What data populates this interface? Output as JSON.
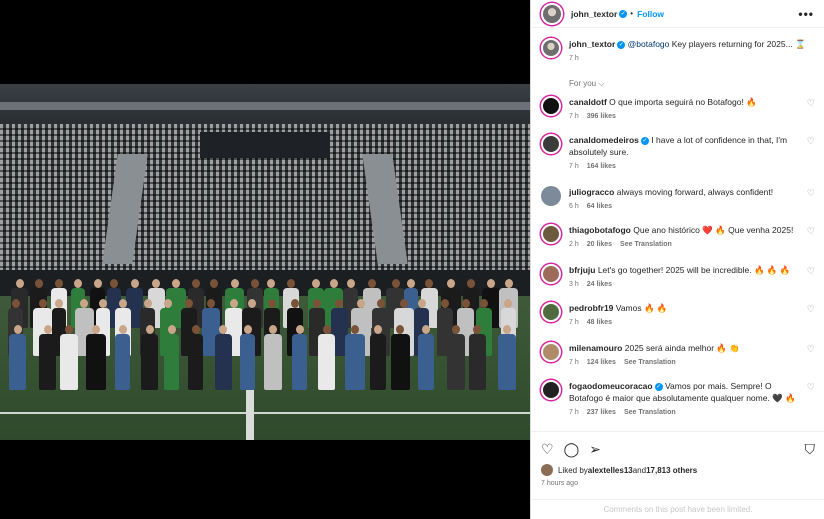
{
  "header": {
    "username": "john_textor",
    "verified_mark": "✓",
    "follow_label": "Follow",
    "more_label": "•••"
  },
  "caption": {
    "username": "john_textor",
    "mention": "@botafogo",
    "text": " Key players returning for 2025... ⌛",
    "time": "7 h"
  },
  "for_you_label": "For you ⌵",
  "comments": [
    {
      "username": "canaldotf",
      "verified": false,
      "text": "O que importa seguirá no Botafogo! 🔥",
      "time": "7 h",
      "likes": "396 likes",
      "translate": "",
      "avatar_color": "#111111"
    },
    {
      "username": "canaldomedeiros",
      "verified": true,
      "text": "I have a lot of confidence in that, I'm absolutely sure.",
      "time": "7 h",
      "likes": "164 likes",
      "translate": "",
      "avatar_color": "#3b3b3b"
    },
    {
      "username": "juliogracco",
      "verified": false,
      "text": "always moving forward, always confident!",
      "time": "6 h",
      "likes": "64 likes",
      "translate": "",
      "avatar_color": "#7d8a99"
    },
    {
      "username": "thiagobotafogo",
      "verified": false,
      "text": "Que ano histórico ❤️ 🔥 Que venha 2025!",
      "time": "2 h",
      "likes": "20 likes",
      "translate": "See Translation",
      "avatar_color": "#6b5a3e"
    },
    {
      "username": "bfrjuju",
      "verified": false,
      "text": "Let's go together! 2025 will be incredible. 🔥 🔥 🔥",
      "time": "3 h",
      "likes": "24 likes",
      "translate": "",
      "avatar_color": "#9c6b5a"
    },
    {
      "username": "pedrobfr19",
      "verified": false,
      "text": "Vamos 🔥 🔥",
      "time": "7 h",
      "likes": "48 likes",
      "translate": "",
      "avatar_color": "#4f6b3f"
    },
    {
      "username": "milenamouro",
      "verified": false,
      "text": "2025 será ainda melhor 🔥 👏",
      "time": "7 h",
      "likes": "124 likes",
      "translate": "See Translation",
      "avatar_color": "#b08b6a"
    },
    {
      "username": "fogaodomeucoracao",
      "verified": true,
      "text": "Vamos por mais. Sempre! O Botafogo é maior que absolutamente qualquer nome. 🖤 🔥",
      "time": "7 h",
      "likes": "237 likes",
      "translate": "See Translation",
      "avatar_color": "#222222"
    }
  ],
  "actions": {
    "heart_icon": "♡",
    "comment_icon": "◯",
    "share_icon": "➢",
    "bookmark_icon": "⛉"
  },
  "liked_by": {
    "prefix": "Liked by ",
    "user": "alextelles13",
    "middle": " and ",
    "others": "17,813 others"
  },
  "posted_ago": "7 hours ago",
  "comments_limited": "Comments on this post have been limited."
}
